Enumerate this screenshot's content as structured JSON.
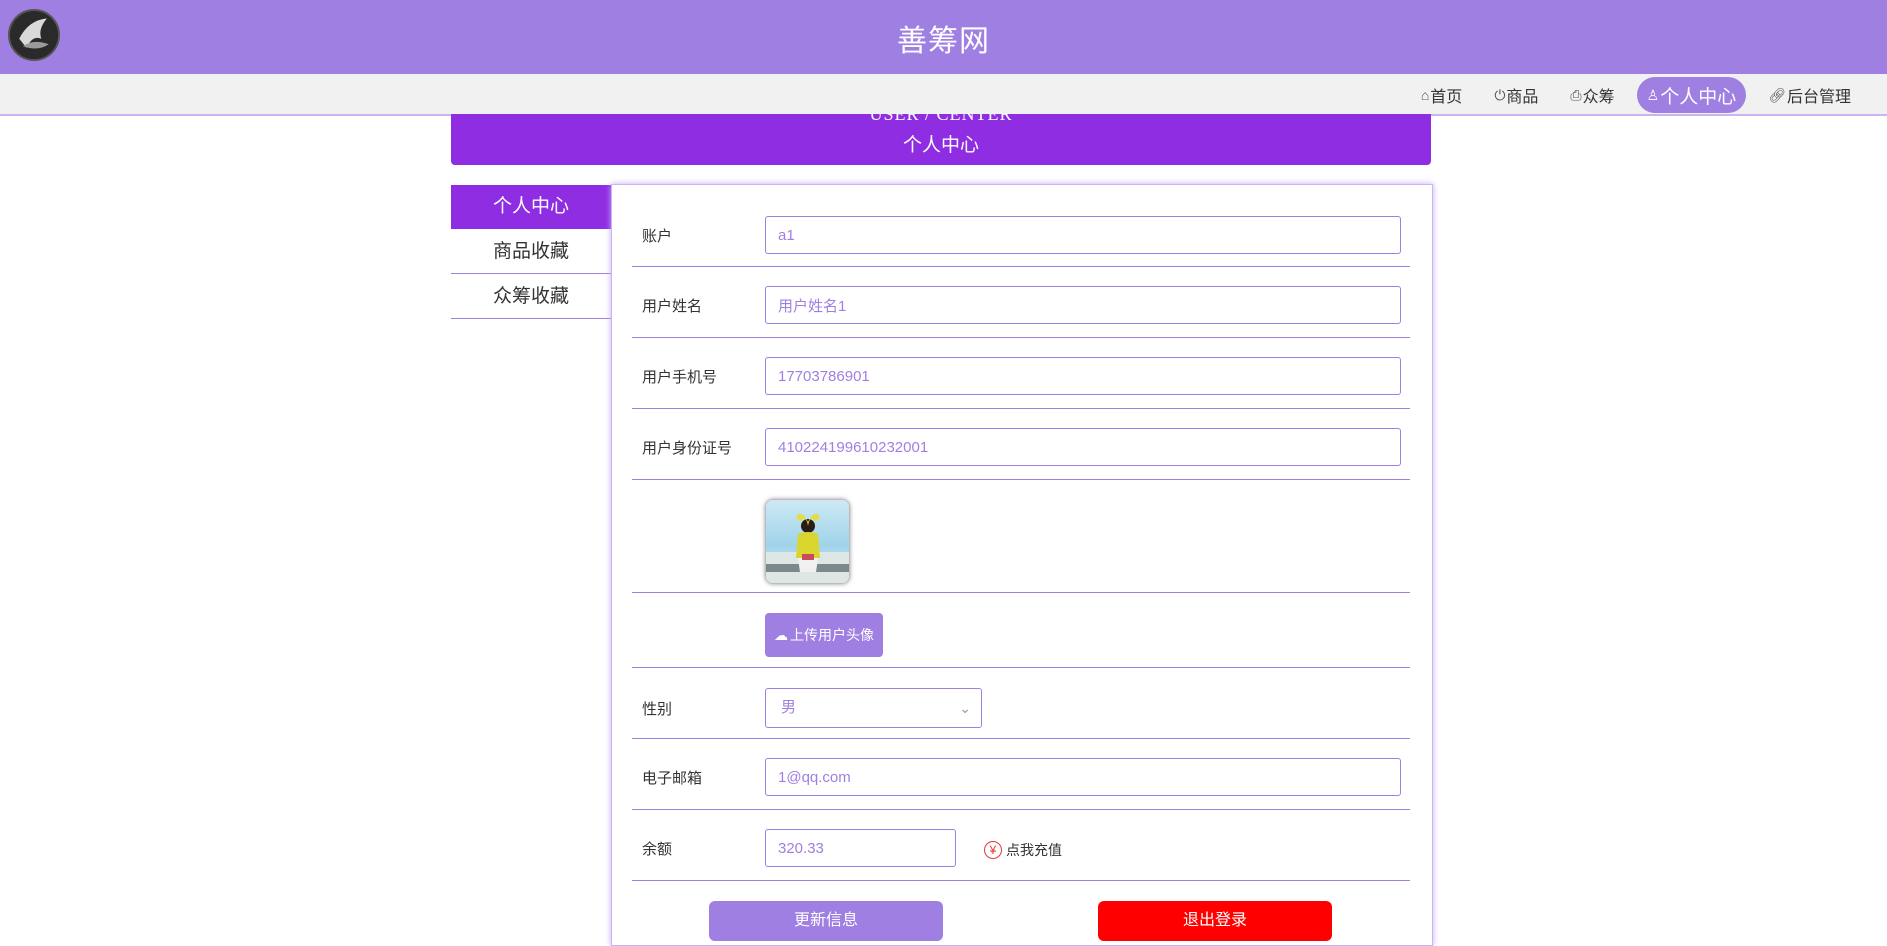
{
  "header": {
    "site_title": "善筹网"
  },
  "nav": {
    "items": [
      {
        "label": "首页",
        "icon": "home-icon"
      },
      {
        "label": "商品",
        "icon": "power-icon"
      },
      {
        "label": "众筹",
        "icon": "printer-icon"
      },
      {
        "label": "个人中心",
        "icon": "user-icon",
        "active": true
      },
      {
        "label": "后台管理",
        "icon": "link-icon"
      }
    ]
  },
  "banner": {
    "en_title": "USER / CENTER",
    "cn_title": "个人中心"
  },
  "sidebar": {
    "items": [
      {
        "label": "个人中心",
        "active": true
      },
      {
        "label": "商品收藏"
      },
      {
        "label": "众筹收藏"
      }
    ]
  },
  "form": {
    "account": {
      "label": "账户",
      "value": "a1"
    },
    "name": {
      "label": "用户姓名",
      "value": "用户姓名1"
    },
    "phone": {
      "label": "用户手机号",
      "value": "17703786901"
    },
    "id_card": {
      "label": "用户身份证号",
      "value": "410224199610232001"
    },
    "upload_label": "上传用户头像",
    "gender": {
      "label": "性别",
      "value": "男"
    },
    "email": {
      "label": "电子邮箱",
      "value": "1@qq.com"
    },
    "balance": {
      "label": "余额",
      "value": "320.33",
      "recharge_label": "点我充值"
    },
    "update_button": "更新信息",
    "logout_button": "退出登录"
  },
  "colors": {
    "primary": "#a07fe3",
    "banner": "#8e2de2",
    "danger": "#ff0000"
  }
}
